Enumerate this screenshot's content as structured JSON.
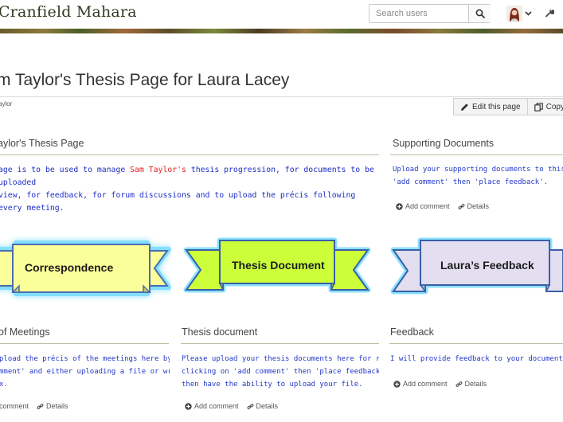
{
  "header": {
    "site_name": "Cranfield Mahara",
    "search_placeholder": "Search users"
  },
  "page": {
    "title": "m Taylor's Thesis Page for Laura Lacey",
    "owner": "aylor",
    "edit_label": "Edit this page",
    "copy_label": "Copy"
  },
  "blocks": {
    "intro": {
      "title": "aylor's Thesis Page",
      "line1_pre": "age is to be used to manage ",
      "line1_name": "Sam Taylor's",
      "line1_post": " thesis progression, for documents to be uploaded",
      "line2": "view, for feedback, for forum discussions and to upload the précis following every meeting."
    },
    "supporting": {
      "title": "Supporting Documents",
      "line1": "Upload your supporting documents to this area by c",
      "line2": "'add comment' then 'place feedback'.",
      "add_comment": "Add comment",
      "details": "Details"
    },
    "ribbons": {
      "correspondence": "Correspondence",
      "thesis": "Thesis Document",
      "feedback": "Laura’s Feedback"
    },
    "meetings": {
      "title": "of Meetings",
      "line1": "pload the précis of the meetings here by clicking",
      "line2": "mment' and either uploading a file or writing in the",
      "line3": "x.",
      "add_comment": "comment",
      "details": "Details"
    },
    "thesis_doc": {
      "title": "Thesis document",
      "line1": "Please upload your thesis documents here for review by",
      "line2": "clicking on 'add comment' then 'place feedback'. You'll",
      "line3": "then have the ability to upload your file.",
      "add_comment": "Add comment",
      "details": "Details"
    },
    "feedback": {
      "title": "Feedback",
      "line1": "I will provide feedback to your documents here.",
      "add_comment": "Add comment",
      "details": "Details"
    }
  },
  "colors": {
    "body_text": "#2338c8",
    "highlight": "#e01b1b",
    "rule": "#b7c3a2",
    "ribbon_yellow": "#fbff9a",
    "ribbon_lime": "#ccff3a",
    "ribbon_lavender": "#e3def0",
    "ribbon_glow": "#63d8ff"
  }
}
